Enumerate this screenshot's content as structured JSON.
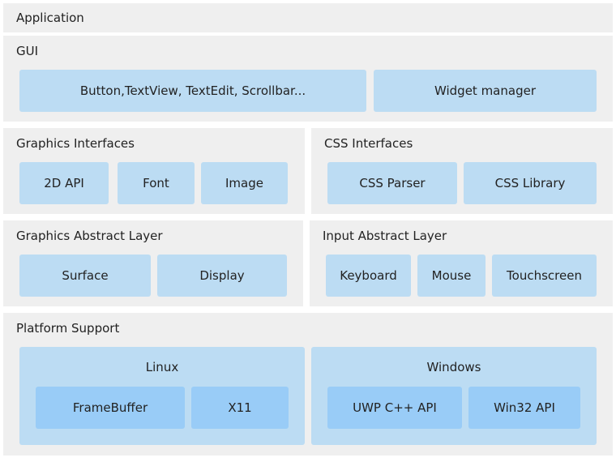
{
  "application": "Application",
  "gui": {
    "title": "GUI",
    "items": [
      "Button,TextView, TextEdit, Scrollbar...",
      "Widget manager"
    ]
  },
  "graphics_interfaces": {
    "title": "Graphics Interfaces",
    "items": [
      "2D API",
      "Font",
      "Image"
    ]
  },
  "css_interfaces": {
    "title": "CSS Interfaces",
    "items": [
      "CSS Parser",
      "CSS Library"
    ]
  },
  "graphics_abstract": {
    "title": "Graphics Abstract Layer",
    "items": [
      "Surface",
      "Display"
    ]
  },
  "input_abstract": {
    "title": "Input Abstract Layer",
    "items": [
      "Keyboard",
      "Mouse",
      "Touchscreen"
    ]
  },
  "platform": {
    "title": "Platform Support",
    "linux": {
      "title": "Linux",
      "items": [
        "FrameBuffer",
        "X11"
      ]
    },
    "windows": {
      "title": "Windows",
      "items": [
        "UWP C++ API",
        "Win32 API"
      ]
    }
  },
  "colors": {
    "panel": "#efefef",
    "box": "#bcdcf3",
    "inner_box": "#99ccf7"
  }
}
